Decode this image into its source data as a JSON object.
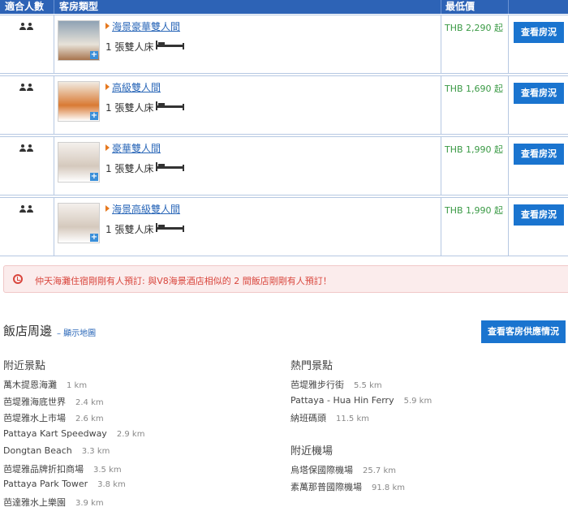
{
  "table": {
    "headers": {
      "guests": "適合人數",
      "room_type": "客房類型",
      "lowest_price": "最低價"
    },
    "rooms": [
      {
        "name": "海景豪華雙人間",
        "bed": "1 張雙人床",
        "price": "THB 2,290 起",
        "button": "查看房況",
        "thumb_colors": [
          "#8fa2b4",
          "#e7e2d8",
          "#a7744d"
        ]
      },
      {
        "name": "高級雙人間",
        "bed": "1 張雙人床",
        "price": "THB 1,690 起",
        "button": "查看房況",
        "thumb_colors": [
          "#f1ebe2",
          "#d97a34",
          "#ffffff"
        ]
      },
      {
        "name": "豪華雙人間",
        "bed": "1 張雙人床",
        "price": "THB 1,990 起",
        "button": "查看房況",
        "thumb_colors": [
          "#f4f0ec",
          "#d5c9bd",
          "#ffffff"
        ]
      },
      {
        "name": "海景高級雙人間",
        "bed": "1 張雙人床",
        "price": "THB 1,990 起",
        "button": "查看房況",
        "thumb_colors": [
          "#f4f0ec",
          "#d5c9bd",
          "#ffffff"
        ]
      }
    ]
  },
  "alert": {
    "text": "仲天海灘住宿剛剛有人預訂: 與V8海景酒店相似的 2 間飯店剛剛有人預訂！",
    "color": "#d9463d"
  },
  "surroundings": {
    "title": "飯店周邊",
    "map_link": "– 顯示地圖",
    "availability_button": "查看客房供應情況",
    "nearby_attractions": {
      "heading": "附近景點",
      "items": [
        {
          "name": "萬木提恩海灘",
          "distance": "1 km"
        },
        {
          "name": "芭堤雅海底世界",
          "distance": "2.4 km"
        },
        {
          "name": "芭堤雅水上市場",
          "distance": "2.6 km"
        },
        {
          "name": "Pattaya Kart Speedway",
          "distance": "2.9 km"
        },
        {
          "name": "Dongtan Beach",
          "distance": "3.3 km"
        },
        {
          "name": "芭堤雅品牌折扣商場",
          "distance": "3.5 km"
        },
        {
          "name": "Pattaya Park Tower",
          "distance": "3.8 km"
        },
        {
          "name": "芭達雅水上樂園",
          "distance": "3.9 km"
        }
      ]
    },
    "popular_attractions": {
      "heading": "熱門景點",
      "items": [
        {
          "name": "芭堤雅步行街",
          "distance": "5.5 km"
        },
        {
          "name": "Pattaya - Hua Hin Ferry",
          "distance": "5.9 km"
        },
        {
          "name": "納班碼頭",
          "distance": "11.5 km"
        }
      ]
    },
    "nearby_airports": {
      "heading": "附近機場",
      "items": [
        {
          "name": "烏塔保國際機場",
          "distance": "25.7 km"
        },
        {
          "name": "素萬那普國際機場",
          "distance": "91.8 km"
        }
      ]
    }
  },
  "colors": {
    "header_bg": "#2d63b6",
    "button_bg": "#1a74cf",
    "price_green": "#3a9a45",
    "link_blue": "#2a67b8"
  },
  "icons": {
    "guests": "two-person-icon",
    "bed": "double-bed-icon",
    "alert": "alarm-clock-icon",
    "room_direction": "orange-arrow-icon"
  }
}
